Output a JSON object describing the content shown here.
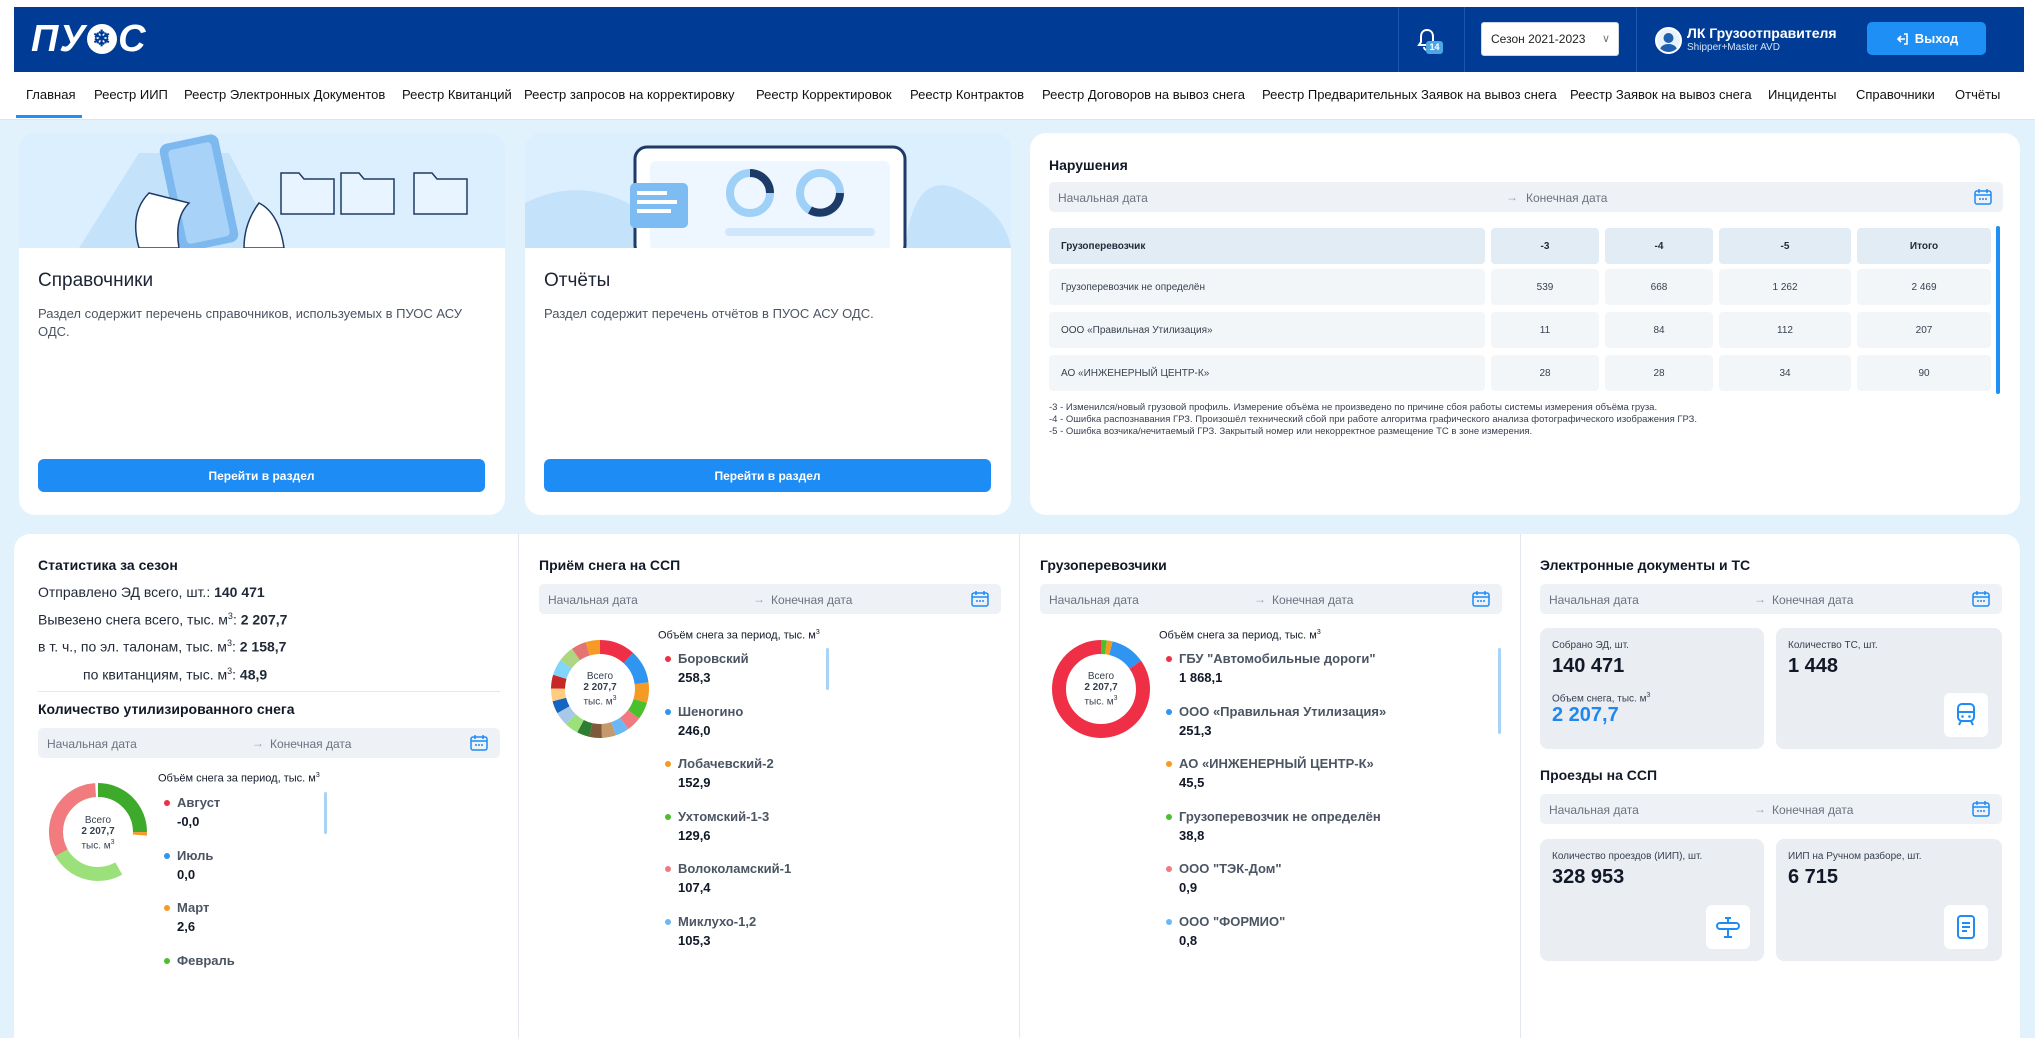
{
  "header": {
    "logo": "ПУ ОС",
    "notifications_count": "14",
    "season": "Сезон 2021-2023",
    "user_name": "ЛК Грузоотправителя",
    "user_role": "Shipper+Master AVD",
    "logout_label": "Выход",
    "brand_color": "#003c96",
    "accent_color": "#1e90f5"
  },
  "nav": {
    "items": [
      "Главная",
      "Реестр ИИП",
      "Реестр Электронных Документов",
      "Реестр Квитанций",
      "Реестр запросов на корректировку",
      "Реестр Корректировок",
      "Реестр Контрактов",
      "Реестр Договоров на вывоз снега",
      "Реестр Предварительных Заявок на вывоз снега",
      "Реестр Заявок на вывоз снега",
      "Инциденты",
      "Справочники",
      "Отчёты"
    ],
    "active": "Главная"
  },
  "cards": {
    "references": {
      "title": "Справочники",
      "desc": "Раздел содержит перечень справочников, используемых в ПУОС АСУ ОДС.",
      "button": "Перейти в раздел"
    },
    "reports": {
      "title": "Отчёты",
      "desc": "Раздел содержит перечень отчётов в ПУОС АСУ ОДС.",
      "button": "Перейти в раздел"
    }
  },
  "date_placeholders": {
    "start": "Начальная дата",
    "end": "Конечная дата",
    "arrow": "→"
  },
  "violations": {
    "title": "Нарушения",
    "headers": [
      "Грузоперевозчик",
      "-3",
      "-4",
      "-5",
      "Итого"
    ],
    "rows": [
      [
        "Грузоперевозчик не определён",
        "539",
        "668",
        "1 262",
        "2 469"
      ],
      [
        "ООО «Правильная Утилизация»",
        "11",
        "84",
        "112",
        "207"
      ],
      [
        "АО «ИНЖЕНЕРНЫЙ ЦЕНТР-К»",
        "28",
        "28",
        "34",
        "90"
      ]
    ],
    "notes": [
      "-3 - Изменился/новый грузовой профиль. Измерение объёма не произведено по причине сбоя работы системы измерения объёма груза.",
      "-4 - Ошибка распознавания ГРЗ. Произошёл технический сбой при работе алгоритма графического анализа фотографического изображения ГРЗ.",
      "-5 - Ошибка возчика/нечитаемый ГРЗ. Закрытый номер или некорректное размещение ТС в зоне измерения."
    ]
  },
  "season_stats": {
    "title": "Статистика за сезон",
    "sent_label": "Отправлено ЭД всего, шт.:",
    "sent_value": "140 471",
    "removed_label_a": "Вывезено снега всего, тыс. м",
    "removed_value": "2 207,7",
    "tickets_label_a": "в т. ч., по эл. талонам, тыс. м",
    "tickets_value": "2 158,7",
    "receipts_label_a": "по квитанциям, тыс. м",
    "receipts_value": "48,9",
    "sup": "3",
    "colon": ":"
  },
  "utilized": {
    "title": "Количество утилизированного снега",
    "legend_title": "Объём снега за период, тыс. м",
    "center_label": "Всего",
    "center_value": "2 207,7",
    "center_unit": "тыс. м",
    "items": [
      {
        "label": "Август",
        "value": "-0,0",
        "color": "#ef2f45"
      },
      {
        "label": "Июль",
        "value": "0,0",
        "color": "#2f95f0"
      },
      {
        "label": "Март",
        "value": "2,6",
        "color": "#f59a23"
      },
      {
        "label": "Февраль",
        "value": "",
        "color": "#4cbf2f"
      }
    ]
  },
  "ssp_intake": {
    "title": "Приём снега на ССП",
    "legend_title": "Объём снега за период, тыс. м",
    "center_label": "Всего",
    "center_value": "2 207,7",
    "center_unit": "тыс. м",
    "items": [
      {
        "label": "Боровский",
        "value": "258,3",
        "color": "#ef2f45"
      },
      {
        "label": "Шеногино",
        "value": "246,0",
        "color": "#2f95f0"
      },
      {
        "label": "Лобачевский-2",
        "value": "152,9",
        "color": "#f59a23"
      },
      {
        "label": "Ухтомский-1-3",
        "value": "129,6",
        "color": "#4cbf2f"
      },
      {
        "label": "Волоколамский-1",
        "value": "107,4",
        "color": "#f07a80"
      },
      {
        "label": "Миклухо-1,2",
        "value": "105,3",
        "color": "#6ab8f5"
      }
    ]
  },
  "carriers": {
    "title": "Грузоперевозчики",
    "legend_title": "Объём снега за период, тыс. м",
    "center_label": "Всего",
    "center_value": "2 207,7",
    "center_unit": "тыс. м",
    "items": [
      {
        "label": "ГБУ \"Автомобильные дороги\"",
        "value": "1 868,1",
        "color": "#ef2f45"
      },
      {
        "label": "ООО «Правильная Утилизация»",
        "value": "251,3",
        "color": "#2f95f0"
      },
      {
        "label": "АО «ИНЖЕНЕРНЫЙ ЦЕНТР-К»",
        "value": "45,5",
        "color": "#f59a23"
      },
      {
        "label": "Грузоперевозчик не определён",
        "value": "38,8",
        "color": "#4cbf2f"
      },
      {
        "label": "ООО \"ТЭК-Дом\"",
        "value": "0,9",
        "color": "#f07a80"
      },
      {
        "label": "ООО \"ФОРМИО\"",
        "value": "0,8",
        "color": "#6ab8f5"
      }
    ]
  },
  "edocs": {
    "title": "Электронные документы и ТС",
    "collected_label": "Собрано ЭД, шт.",
    "collected_value": "140 471",
    "volume_label": "Объем снега, тыс. м",
    "volume_value": "2 207,7",
    "vehicles_label": "Количество ТС, шт.",
    "vehicles_value": "1 448"
  },
  "passes": {
    "title": "Проезды на ССП",
    "count_label": "Количество проездов (ИИП), шт.",
    "count_value": "328 953",
    "manual_label": "ИИП на Ручном разборе, шт.",
    "manual_value": "6 715"
  }
}
